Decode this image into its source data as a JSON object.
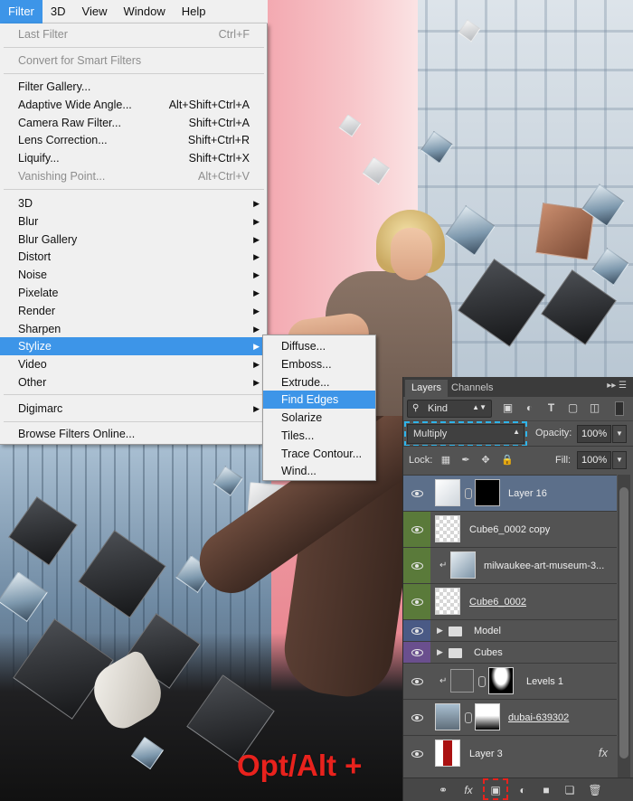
{
  "menubar": {
    "items": [
      "Filter",
      "3D",
      "View",
      "Window",
      "Help"
    ]
  },
  "filter_menu": {
    "last_filter": {
      "label": "Last Filter",
      "shortcut": "Ctrl+F"
    },
    "convert_smart": "Convert for Smart Filters",
    "filter_gallery": "Filter Gallery...",
    "adaptive": {
      "label": "Adaptive Wide Angle...",
      "shortcut": "Alt+Shift+Ctrl+A"
    },
    "camera_raw": {
      "label": "Camera Raw Filter...",
      "shortcut": "Shift+Ctrl+A"
    },
    "lens": {
      "label": "Lens Correction...",
      "shortcut": "Shift+Ctrl+R"
    },
    "liquify": {
      "label": "Liquify...",
      "shortcut": "Shift+Ctrl+X"
    },
    "vanishing": {
      "label": "Vanishing Point...",
      "shortcut": "Alt+Ctrl+V"
    },
    "submenus": [
      "3D",
      "Blur",
      "Blur Gallery",
      "Distort",
      "Noise",
      "Pixelate",
      "Render",
      "Sharpen",
      "Stylize",
      "Video",
      "Other"
    ],
    "digimarc": "Digimarc",
    "browse": "Browse Filters Online..."
  },
  "stylize_menu": [
    "Diffuse...",
    "Emboss...",
    "Extrude...",
    "Find Edges",
    "Solarize",
    "Tiles...",
    "Trace Contour...",
    "Wind..."
  ],
  "layers_panel": {
    "tabs": [
      "Layers",
      "Channels"
    ],
    "kind": "Kind",
    "blend_mode": "Multiply",
    "opacity_label": "Opacity:",
    "opacity": "100%",
    "lock_label": "Lock:",
    "fill_label": "Fill:",
    "fill": "100%",
    "layers": [
      "Layer 16",
      "Cube6_0002 copy",
      "milwaukee-art-museum-3...",
      "Cube6_0002",
      "Model",
      "Cubes",
      "Levels 1",
      "dubai-639302",
      "Layer 3"
    ],
    "fx": "fx"
  },
  "overlay_text": "Opt/Alt +",
  "colors": {
    "menu_highlight": "#3d95e8",
    "selected_layer": "#5c6f8a",
    "green_label": "#5a7a3a",
    "blue_label": "#4a5a85",
    "purple_label": "#6a4f8e",
    "focus_cyan": "#2fb4ea",
    "focus_red": "#e8221d"
  }
}
